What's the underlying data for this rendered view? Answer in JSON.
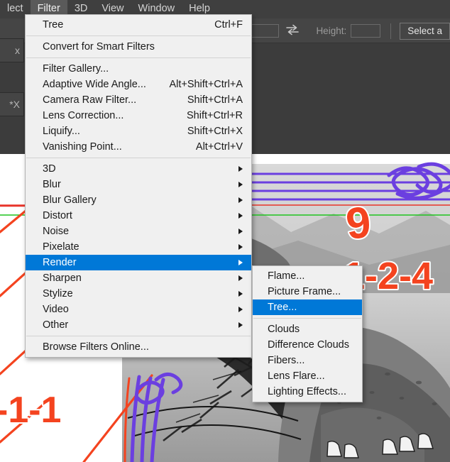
{
  "menubar": {
    "items": [
      {
        "label": "lect",
        "active": false
      },
      {
        "label": "Filter",
        "active": true
      },
      {
        "label": "3D",
        "active": false
      },
      {
        "label": "View",
        "active": false
      },
      {
        "label": "Window",
        "active": false
      },
      {
        "label": "Help",
        "active": false
      }
    ]
  },
  "options_bar": {
    "width_value": "",
    "swap_icon": "swap-arrows-icon",
    "height_label": "Height:",
    "height_value": "",
    "select_button_label": "Select a"
  },
  "left_tabs": [
    {
      "label": "x",
      "modified": false
    },
    {
      "label": "*X",
      "modified": true
    }
  ],
  "filter_menu": {
    "groups": [
      {
        "items": [
          {
            "label": "Tree",
            "accel": "Ctrl+F",
            "submenu": false,
            "selected": false
          }
        ]
      },
      {
        "items": [
          {
            "label": "Convert for Smart Filters",
            "accel": "",
            "submenu": false,
            "selected": false
          }
        ]
      },
      {
        "items": [
          {
            "label": "Filter Gallery...",
            "accel": "",
            "submenu": false,
            "selected": false
          },
          {
            "label": "Adaptive Wide Angle...",
            "accel": "Alt+Shift+Ctrl+A",
            "submenu": false,
            "selected": false
          },
          {
            "label": "Camera Raw Filter...",
            "accel": "Shift+Ctrl+A",
            "submenu": false,
            "selected": false
          },
          {
            "label": "Lens Correction...",
            "accel": "Shift+Ctrl+R",
            "submenu": false,
            "selected": false
          },
          {
            "label": "Liquify...",
            "accel": "Shift+Ctrl+X",
            "submenu": false,
            "selected": false
          },
          {
            "label": "Vanishing Point...",
            "accel": "Alt+Ctrl+V",
            "submenu": false,
            "selected": false
          }
        ]
      },
      {
        "items": [
          {
            "label": "3D",
            "accel": "",
            "submenu": true,
            "selected": false
          },
          {
            "label": "Blur",
            "accel": "",
            "submenu": true,
            "selected": false
          },
          {
            "label": "Blur Gallery",
            "accel": "",
            "submenu": true,
            "selected": false
          },
          {
            "label": "Distort",
            "accel": "",
            "submenu": true,
            "selected": false
          },
          {
            "label": "Noise",
            "accel": "",
            "submenu": true,
            "selected": false
          },
          {
            "label": "Pixelate",
            "accel": "",
            "submenu": true,
            "selected": false
          },
          {
            "label": "Render",
            "accel": "",
            "submenu": true,
            "selected": true
          },
          {
            "label": "Sharpen",
            "accel": "",
            "submenu": true,
            "selected": false
          },
          {
            "label": "Stylize",
            "accel": "",
            "submenu": true,
            "selected": false
          },
          {
            "label": "Video",
            "accel": "",
            "submenu": true,
            "selected": false
          },
          {
            "label": "Other",
            "accel": "",
            "submenu": true,
            "selected": false
          }
        ]
      },
      {
        "items": [
          {
            "label": "Browse Filters Online...",
            "accel": "",
            "submenu": false,
            "selected": false
          }
        ]
      }
    ]
  },
  "render_submenu": {
    "groups": [
      {
        "items": [
          {
            "label": "Flame...",
            "accel": "",
            "submenu": false,
            "selected": false
          },
          {
            "label": "Picture Frame...",
            "accel": "",
            "submenu": false,
            "selected": false
          },
          {
            "label": "Tree...",
            "accel": "",
            "submenu": false,
            "selected": true
          }
        ]
      },
      {
        "items": [
          {
            "label": "Clouds",
            "accel": "",
            "submenu": false,
            "selected": false
          },
          {
            "label": "Difference Clouds",
            "accel": "",
            "submenu": false,
            "selected": false
          },
          {
            "label": "Fibers...",
            "accel": "",
            "submenu": false,
            "selected": false
          },
          {
            "label": "Lens Flare...",
            "accel": "",
            "submenu": false,
            "selected": false
          },
          {
            "label": "Lighting Effects...",
            "accel": "",
            "submenu": false,
            "selected": false
          }
        ]
      }
    ]
  },
  "canvas": {
    "annotations": [
      {
        "text": "9",
        "color": "#f4431f"
      },
      {
        "text": "1-2-4",
        "color": "#f4431f"
      },
      {
        "text": "-1-1",
        "color": "#f4431f"
      }
    ],
    "guide_colors": {
      "red": "#e8352a",
      "green": "#1fc41f",
      "purple": "#6b3fe0"
    }
  },
  "colors": {
    "menu_bg": "#f0f0f0",
    "menu_text": "#1a1a1a",
    "highlight": "#0078d7",
    "highlight_text": "#ffffff",
    "chrome_bg": "#3f3f3f",
    "options_bg": "#454545"
  }
}
